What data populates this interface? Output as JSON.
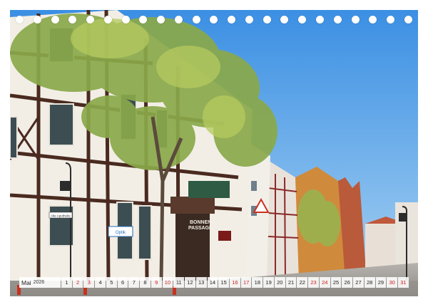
{
  "calendar": {
    "month": "Mai",
    "year": "2026",
    "days": [
      {
        "n": "1",
        "w": false
      },
      {
        "n": "2",
        "w": true
      },
      {
        "n": "3",
        "w": true
      },
      {
        "n": "4",
        "w": false
      },
      {
        "n": "5",
        "w": false
      },
      {
        "n": "6",
        "w": false
      },
      {
        "n": "7",
        "w": false
      },
      {
        "n": "8",
        "w": false
      },
      {
        "n": "9",
        "w": true
      },
      {
        "n": "10",
        "w": true
      },
      {
        "n": "11",
        "w": false
      },
      {
        "n": "12",
        "w": false
      },
      {
        "n": "13",
        "w": false
      },
      {
        "n": "14",
        "w": false
      },
      {
        "n": "15",
        "w": false
      },
      {
        "n": "16",
        "w": true
      },
      {
        "n": "17",
        "w": true
      },
      {
        "n": "18",
        "w": false
      },
      {
        "n": "19",
        "w": false
      },
      {
        "n": "20",
        "w": false
      },
      {
        "n": "21",
        "w": false
      },
      {
        "n": "22",
        "w": false
      },
      {
        "n": "23",
        "w": true
      },
      {
        "n": "24",
        "w": true
      },
      {
        "n": "25",
        "w": false
      },
      {
        "n": "26",
        "w": false
      },
      {
        "n": "27",
        "w": false
      },
      {
        "n": "28",
        "w": false
      },
      {
        "n": "29",
        "w": false
      },
      {
        "n": "30",
        "w": true
      },
      {
        "n": "31",
        "w": true
      }
    ]
  },
  "signs": {
    "bonnen_line1": "BONNEN",
    "bonnen_line2": "PASSAGE",
    "apotheke": "Alte Apotheke",
    "optik": "Optik"
  },
  "colors": {
    "sky_top": "#3b8fe3",
    "sky_bottom": "#9fcdf2",
    "weekend": "#d21f1f",
    "timber": "#4a2a20",
    "wall": "#f2eee6"
  }
}
